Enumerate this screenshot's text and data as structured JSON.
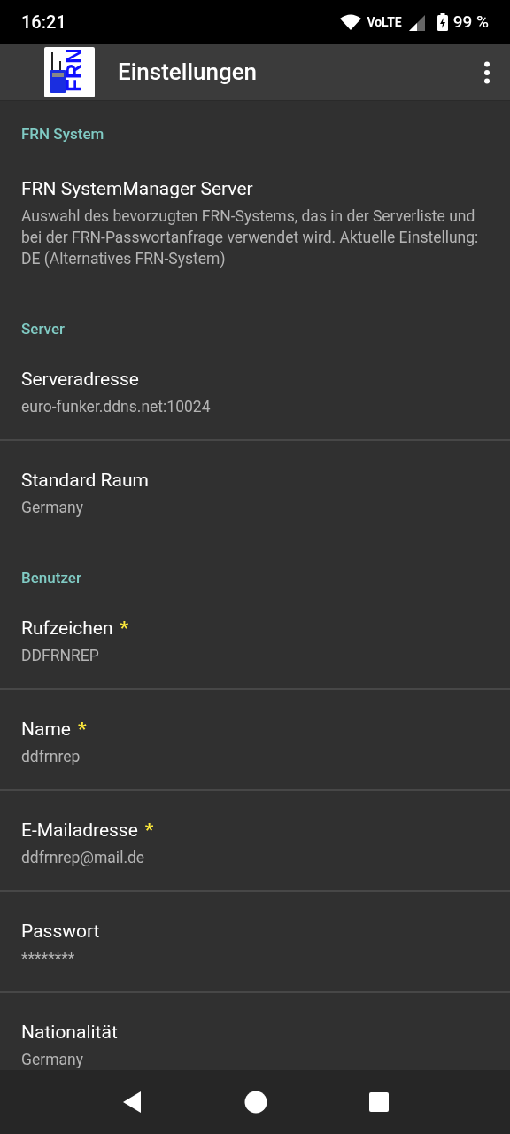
{
  "status_bar": {
    "time": "16:21",
    "network": "VoLTE",
    "battery": "99 %"
  },
  "app_bar": {
    "logo_text": "FRN",
    "title": "Einstellungen"
  },
  "sections": [
    {
      "header": "FRN System",
      "items": [
        {
          "title": "FRN SystemManager Server",
          "summary": "Auswahl des bevorzugten FRN-Systems, das in der Serverliste und bei der FRN-Passwortanfrage verwendet wird. Aktuelle Einstellung: DE (Alternatives FRN-System)"
        }
      ]
    },
    {
      "header": "Server",
      "items": [
        {
          "title": "Serveradresse",
          "summary": "euro-funker.ddns.net:10024"
        },
        {
          "title": "Standard Raum",
          "summary": "Germany"
        }
      ]
    },
    {
      "header": "Benutzer",
      "items": [
        {
          "title": "Rufzeichen",
          "required_mark": "*",
          "summary": "DDFRNREP"
        },
        {
          "title": "Name",
          "required_mark": "*",
          "summary": "ddfrnrep"
        },
        {
          "title": "E-Mailadresse",
          "required_mark": "*",
          "summary": "ddfrnrep@mail.de"
        },
        {
          "title": "Passwort",
          "summary": "********"
        },
        {
          "title": "Nationalität",
          "summary": "Germany"
        }
      ]
    }
  ]
}
